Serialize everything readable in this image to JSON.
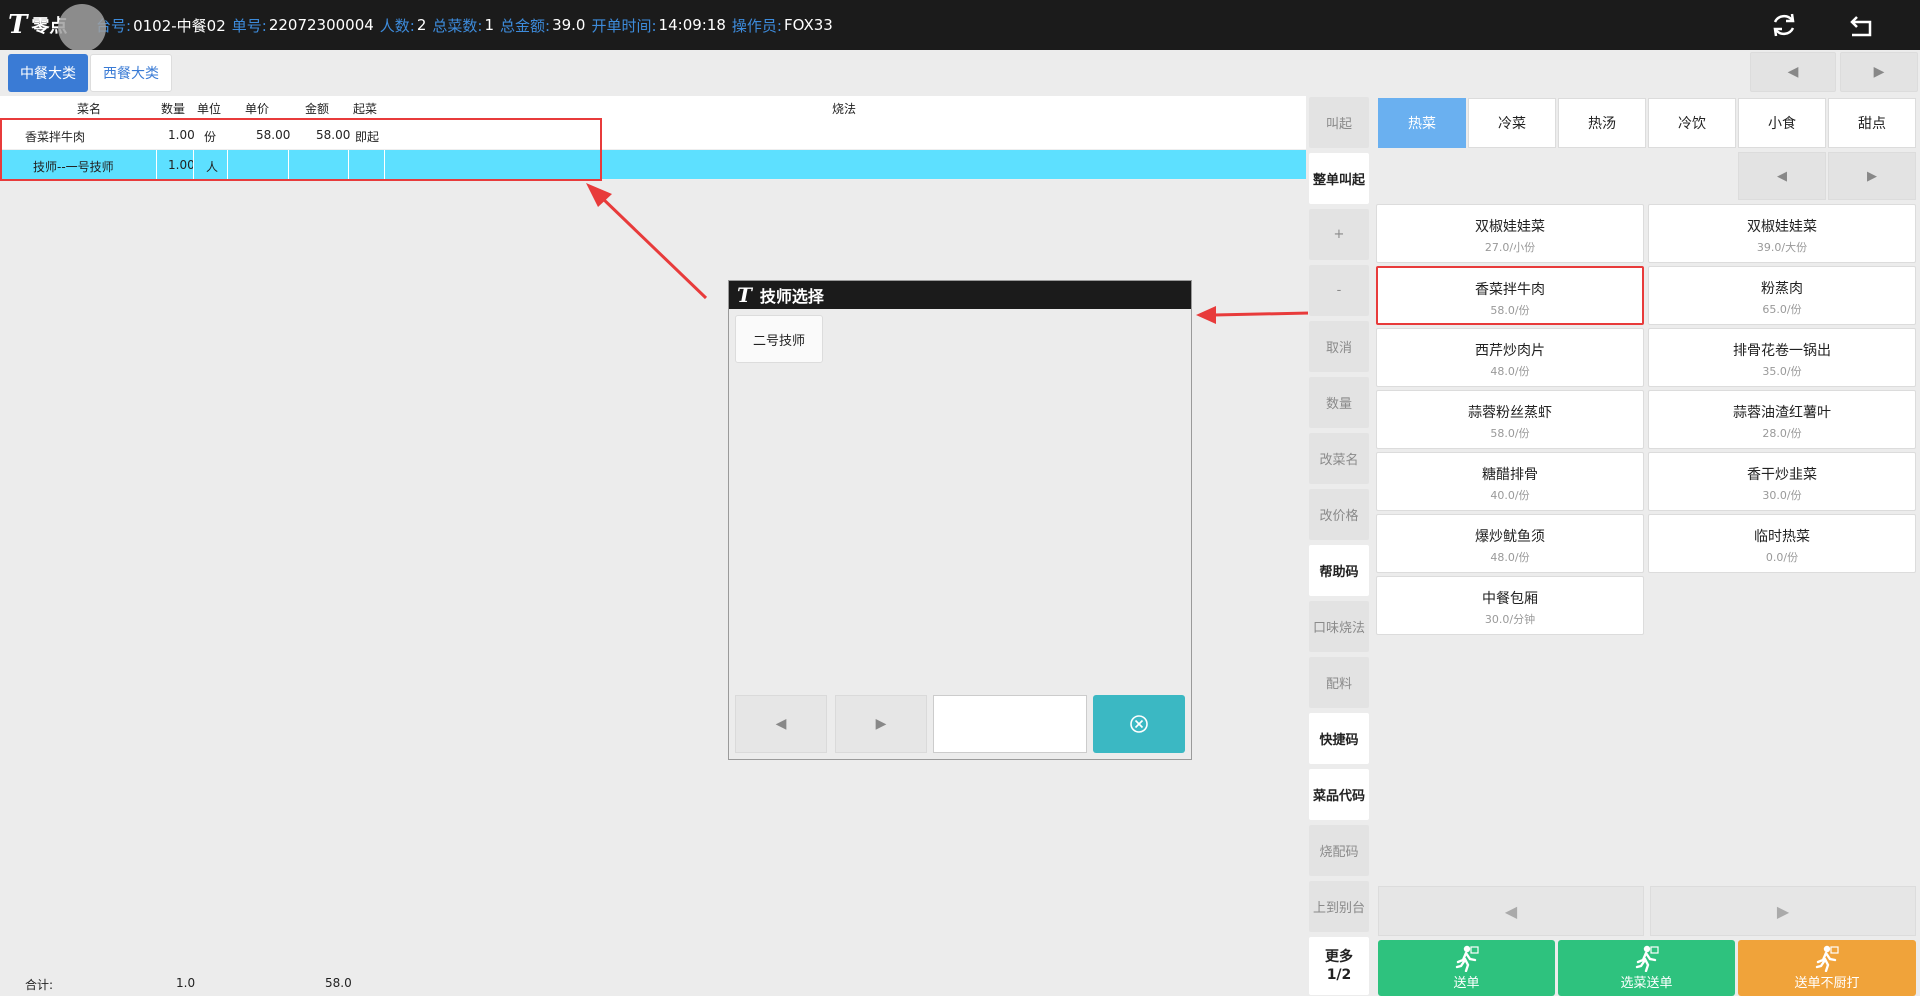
{
  "header": {
    "logo_mark": "T",
    "logo_text": "零点",
    "fields": [
      {
        "key": "台号:",
        "value": "0102-中餐02"
      },
      {
        "key": "单号:",
        "value": "22072300004"
      },
      {
        "key": "人数:",
        "value": "2"
      },
      {
        "key": "总菜数:",
        "value": "1"
      },
      {
        "key": "总金额:",
        "value": "39.0"
      },
      {
        "key": "开单时间:",
        "value": "14:09:18"
      },
      {
        "key": "操作员:",
        "value": "FOX33"
      }
    ],
    "icons": [
      "refresh-icon",
      "return-icon"
    ]
  },
  "category_tabs": [
    {
      "label": "中餐大类",
      "active": true
    },
    {
      "label": "西餐大类",
      "active": false
    }
  ],
  "order": {
    "columns": [
      "菜名",
      "数量",
      "单位",
      "单价",
      "金额",
      "起菜",
      "烧法"
    ],
    "rows": [
      {
        "name": "香菜拌牛肉",
        "qty": "1.00",
        "unit": "份",
        "price": "58.00",
        "amount": "58.00",
        "start": "即起",
        "cook": "",
        "selected": false
      },
      {
        "name": "技师--一号技师",
        "qty": "1.00",
        "unit": "人",
        "price": "",
        "amount": "",
        "start": "",
        "cook": "",
        "selected": true
      }
    ],
    "totals": {
      "label": "合计:",
      "qty": "1.0",
      "amount": "58.0"
    }
  },
  "dialog": {
    "title": "技师选择",
    "options": [
      "二号技师"
    ],
    "search_value": "",
    "prev": "◀",
    "next": "▶"
  },
  "actions": [
    {
      "label": "叫起",
      "enabled": false
    },
    {
      "label": "整单叫起",
      "enabled": true
    },
    {
      "label": "+",
      "enabled": false
    },
    {
      "label": "-",
      "enabled": false
    },
    {
      "label": "取消",
      "enabled": false
    },
    {
      "label": "数量",
      "enabled": false
    },
    {
      "label": "改菜名",
      "enabled": false
    },
    {
      "label": "改价格",
      "enabled": false
    },
    {
      "label": "帮助码",
      "enabled": true
    },
    {
      "label": "口味烧法",
      "enabled": false
    },
    {
      "label": "配料",
      "enabled": false
    },
    {
      "label": "快捷码",
      "enabled": true
    },
    {
      "label": "菜品代码",
      "enabled": true
    },
    {
      "label": "烧配码",
      "enabled": false
    },
    {
      "label": "上到别台",
      "enabled": false
    },
    {
      "label": "更多",
      "sub": "1/2",
      "enabled": true
    }
  ],
  "sub_tabs": [
    {
      "label": "热菜",
      "active": true
    },
    {
      "label": "冷菜",
      "active": false
    },
    {
      "label": "热汤",
      "active": false
    },
    {
      "label": "冷饮",
      "active": false
    },
    {
      "label": "小食",
      "active": false
    },
    {
      "label": "甜点",
      "active": false
    }
  ],
  "dishes": [
    {
      "name": "双椒娃娃菜",
      "price": "27.0/小份"
    },
    {
      "name": "双椒娃娃菜",
      "price": "39.0/大份"
    },
    {
      "name": "香菜拌牛肉",
      "price": "58.0/份",
      "highlight": true
    },
    {
      "name": "粉蒸肉",
      "price": "65.0/份"
    },
    {
      "name": "西芹炒肉片",
      "price": "48.0/份"
    },
    {
      "name": "排骨花卷一锅出",
      "price": "35.0/份"
    },
    {
      "name": "蒜蓉粉丝蒸虾",
      "price": "58.0/份"
    },
    {
      "name": "蒜蓉油渣红薯叶",
      "price": "28.0/份"
    },
    {
      "name": "糖醋排骨",
      "price": "40.0/份"
    },
    {
      "name": "香干炒韭菜",
      "price": "30.0/份"
    },
    {
      "name": "爆炒鱿鱼须",
      "price": "48.0/份"
    },
    {
      "name": "临时热菜",
      "price": "0.0/份"
    },
    {
      "name": "中餐包厢",
      "price": "30.0/分钟"
    }
  ],
  "pager": {
    "prev": "◀",
    "next": "▶"
  },
  "send_buttons": [
    {
      "label": "送单",
      "color": "#2ec27e"
    },
    {
      "label": "选菜送单",
      "color": "#2ec27e"
    },
    {
      "label": "送单不厨打",
      "color": "#f0a33a"
    }
  ],
  "colors": {
    "accent": "#3a7bd5",
    "selected_row": "#5de0ff",
    "dialog_confirm": "#3bb8c3",
    "annotation": "#e83b3b"
  }
}
